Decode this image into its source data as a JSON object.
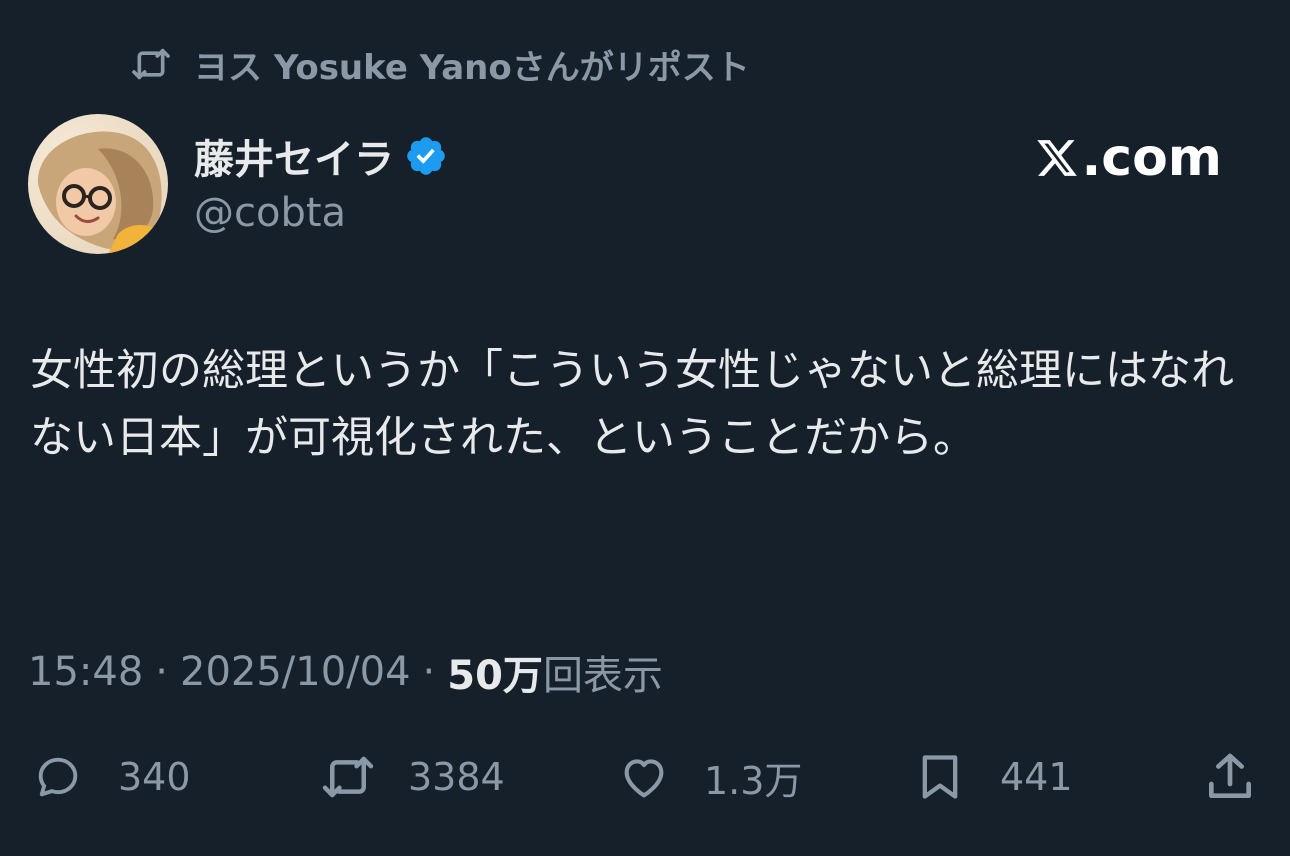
{
  "repost_header": {
    "text": "ヨス Yosuke Yanoさんがリポスト"
  },
  "author": {
    "display_name": "藤井セイラ",
    "handle": "@cobta",
    "verified": true
  },
  "brand": {
    "label": ".com"
  },
  "tweet": {
    "text": "女性初の総理というか「こういう女性じゃないと総理にはなれない日本」が可視化された、ということだから。"
  },
  "meta": {
    "time": "15:48",
    "date": "2025/10/04",
    "views_count": "50万",
    "views_label": "回表示",
    "separator": "·"
  },
  "actions": {
    "replies": "340",
    "reposts": "3384",
    "likes": "1.3万",
    "bookmarks": "441"
  },
  "colors": {
    "background": "#15202b",
    "text_primary": "#e7e9ea",
    "text_muted": "#8b98a5",
    "verified_badge": "#1d9bf0"
  },
  "icons": {
    "repost_header": "repost-icon",
    "verified": "verified-badge-icon",
    "brand": "x-logo-icon",
    "reply": "reply-icon",
    "repost": "repost-icon",
    "like": "heart-icon",
    "bookmark": "bookmark-icon",
    "share": "share-icon"
  }
}
